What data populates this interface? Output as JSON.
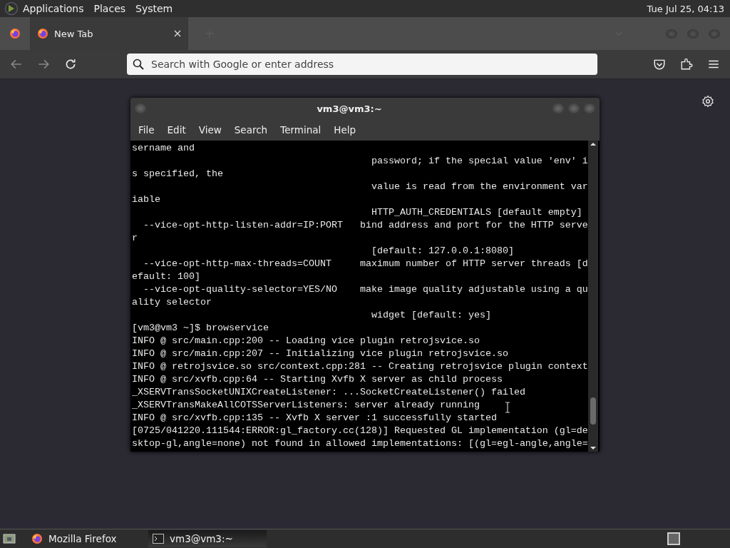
{
  "top_panel": {
    "menus": [
      "Applications",
      "Places",
      "System"
    ],
    "clock": "Tue Jul 25, 04:13"
  },
  "browser": {
    "tabs": [
      {
        "label": "New Tab",
        "selected": true
      }
    ],
    "address": {
      "placeholder": "Search with Google or enter address"
    }
  },
  "terminal": {
    "title": "vm3@vm3:~",
    "menus": [
      "File",
      "Edit",
      "View",
      "Search",
      "Terminal",
      "Help"
    ],
    "lines": [
      "sername and",
      "                                          password; if the special value 'env' i",
      "s specified, the",
      "                                          value is read from the environment var",
      "iable",
      "                                          HTTP_AUTH_CREDENTIALS [default empty]",
      "  --vice-opt-http-listen-addr=IP:PORT   bind address and port for the HTTP serve",
      "r",
      "                                          [default: 127.0.0.1:8080]",
      "  --vice-opt-http-max-threads=COUNT     maximum number of HTTP server threads [d",
      "efault: 100]",
      "  --vice-opt-quality-selector=YES/NO    make image quality adjustable using a qu",
      "ality selector",
      "                                          widget [default: yes]",
      "[vm3@vm3 ~]$ browservice",
      "INFO @ src/main.cpp:200 -- Loading vice plugin retrojsvice.so",
      "INFO @ src/main.cpp:207 -- Initializing vice plugin retrojsvice.so",
      "INFO @ retrojsvice.so src/context.cpp:281 -- Creating retrojsvice plugin context",
      "INFO @ src/xvfb.cpp:64 -- Starting Xvfb X server as child process",
      "_XSERVTransSocketUNIXCreateListener: ...SocketCreateListener() failed",
      "_XSERVTransMakeAllCOTSServerListeners: server already running",
      "INFO @ src/xvfb.cpp:135 -- Xvfb X server :1 successfully started",
      "[0725/041220.111544:ERROR:gl_factory.cc(128)] Requested GL implementation (gl=de",
      "sktop-gl,angle=none) not found in allowed implementations: [(gl=egl-angle,angle="
    ]
  },
  "taskbar": {
    "items": [
      {
        "label": "Mozilla Firefox",
        "kind": "firefox",
        "selected": false
      },
      {
        "label": "vm3@vm3:~",
        "kind": "terminal",
        "selected": true
      }
    ]
  }
}
